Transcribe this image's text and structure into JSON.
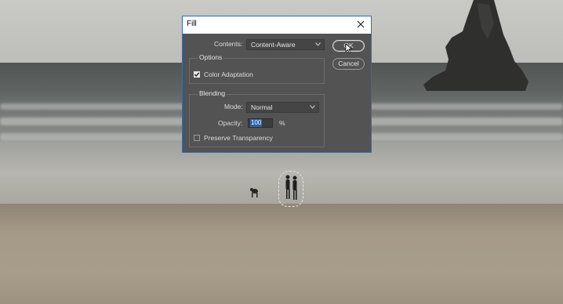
{
  "dialog": {
    "title": "Fill",
    "contents_label": "Contents:",
    "contents_value": "Content-Aware",
    "ok_label": "OK",
    "cancel_label": "Cancel",
    "options_legend": "Options",
    "color_adaptation_label": "Color Adaptation",
    "color_adaptation_checked": true,
    "blending_legend": "Blending",
    "mode_label": "Mode:",
    "mode_value": "Normal",
    "opacity_label": "Opacity:",
    "opacity_value": "100",
    "opacity_unit": "%",
    "preserve_transparency_label": "Preserve Transparency",
    "preserve_transparency_checked": false
  },
  "colors": {
    "dialog_bg": "#535353",
    "dialog_border": "#2f6db5",
    "text": "#dcdcdc",
    "selection_highlight": "#2b62a8"
  },
  "icons": [
    "close-icon",
    "chevron-down-icon",
    "checkmark-icon",
    "mouse-pointer-icon"
  ]
}
